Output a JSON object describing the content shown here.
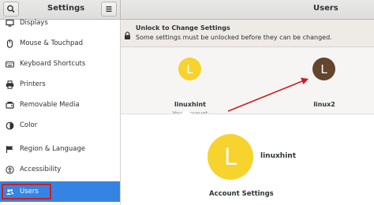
{
  "headerbar": {
    "left_title": "Settings",
    "right_title": "Users"
  },
  "sidebar": {
    "items": [
      {
        "label": "Displays",
        "icon": "display-icon"
      },
      {
        "label": "Mouse & Touchpad",
        "icon": "mouse-icon"
      },
      {
        "label": "Keyboard Shortcuts",
        "icon": "keyboard-icon"
      },
      {
        "label": "Printers",
        "icon": "printer-icon"
      },
      {
        "label": "Removable Media",
        "icon": "media-icon"
      },
      {
        "label": "Color",
        "icon": "color-icon"
      },
      {
        "label": "Region & Language",
        "icon": "region-icon"
      },
      {
        "label": "Accessibility",
        "icon": "accessibility-icon"
      },
      {
        "label": "Users",
        "icon": "users-icon",
        "active": true
      }
    ]
  },
  "banner": {
    "title": "Unlock to Change Settings",
    "subtitle": "Some settings must be unlocked before they can be changed."
  },
  "users": [
    {
      "initial": "L",
      "name": "linuxhint",
      "sub": "Your account",
      "color": "#f6d32d"
    },
    {
      "initial": "L",
      "name": "linux2",
      "sub": "",
      "color": "#63452c"
    }
  ],
  "selected_user": {
    "initial": "L",
    "name": "linuxhint",
    "color": "#f6d32d"
  },
  "account_settings_title": "Account Settings",
  "colors": {
    "accent": "#3584e4",
    "annotation": "#cc1f1f"
  }
}
